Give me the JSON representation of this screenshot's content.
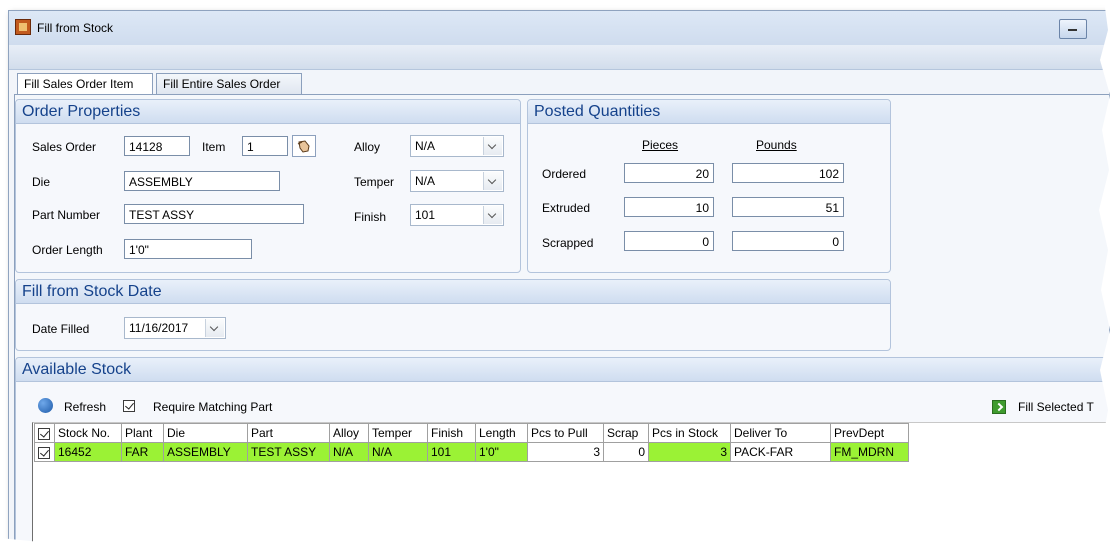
{
  "window": {
    "title": "Fill from Stock"
  },
  "tabs": [
    {
      "label": "Fill Sales Order Item"
    },
    {
      "label": "Fill Entire Sales Order"
    }
  ],
  "order_properties": {
    "header": "Order Properties",
    "sales_order_label": "Sales Order",
    "sales_order_value": "14128",
    "item_label": "Item",
    "item_value": "1",
    "die_label": "Die",
    "die_value": "ASSEMBLY",
    "part_number_label": "Part Number",
    "part_number_value": "TEST ASSY",
    "order_length_label": "Order Length",
    "order_length_value": "1'0\"",
    "alloy_label": "Alloy",
    "alloy_value": "N/A",
    "temper_label": "Temper",
    "temper_value": "N/A",
    "finish_label": "Finish",
    "finish_value": "101"
  },
  "posted_quantities": {
    "header": "Posted Quantities",
    "pieces_header": "Pieces",
    "pounds_header": "Pounds",
    "ordered_label": "Ordered",
    "ordered_pieces": "20",
    "ordered_pounds": "102",
    "extruded_label": "Extruded",
    "extruded_pieces": "10",
    "extruded_pounds": "51",
    "scrapped_label": "Scrapped",
    "scrapped_pieces": "0",
    "scrapped_pounds": "0"
  },
  "fill_date": {
    "header": "Fill from Stock Date",
    "date_label": "Date Filled",
    "date_value": "11/16/2017"
  },
  "available_stock": {
    "header": "Available Stock",
    "refresh_label": "Refresh",
    "require_matching_label": "Require Matching Part",
    "fill_selected_label": "Fill Selected T",
    "columns": [
      "Stock No.",
      "Plant",
      "Die",
      "Part",
      "Alloy",
      "Temper",
      "Finish",
      "Length",
      "Pcs to Pull",
      "Scrap",
      "Pcs in Stock",
      "Deliver To",
      "PrevDept"
    ],
    "rows": [
      {
        "stock_no": "16452",
        "plant": "FAR",
        "die": "ASSEMBLY",
        "part": "TEST ASSY",
        "alloy": "N/A",
        "temper": "N/A",
        "finish": "101",
        "length": "1'0\"",
        "pcs_to_pull": "3",
        "scrap": "0",
        "pcs_in_stock": "3",
        "deliver_to": "PACK-FAR",
        "prev_dept": "FM_MDRN"
      }
    ]
  },
  "colors": {
    "highlight_green": "#9bf235",
    "group_header_text": "#15428b"
  }
}
